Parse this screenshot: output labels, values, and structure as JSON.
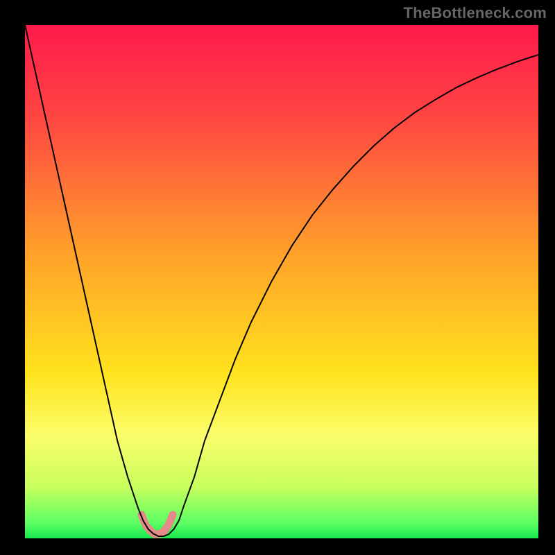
{
  "watermark": "TheBottleneck.com",
  "gradient": {
    "stops": [
      {
        "offset": 0,
        "color": "#ff1a4b"
      },
      {
        "offset": 0.18,
        "color": "#ff4642"
      },
      {
        "offset": 0.45,
        "color": "#ffa329"
      },
      {
        "offset": 0.68,
        "color": "#ffe31d"
      },
      {
        "offset": 0.8,
        "color": "#fbfd6a"
      },
      {
        "offset": 0.9,
        "color": "#c8ff5e"
      },
      {
        "offset": 0.97,
        "color": "#5dff63"
      },
      {
        "offset": 1.0,
        "color": "#17e84e"
      }
    ]
  },
  "curve": {
    "stroke": "#000000",
    "stroke_width": 2
  },
  "highlight": {
    "stroke": "#e58a88",
    "stroke_width": 11,
    "linecap": "round",
    "dot_radius": 5.5
  },
  "chart_data": {
    "type": "line",
    "title": "",
    "xlabel": "",
    "ylabel": "",
    "xlim": [
      0,
      100
    ],
    "ylim": [
      0,
      100
    ],
    "x": [
      0,
      2,
      4,
      6,
      8,
      10,
      12,
      14,
      16,
      18,
      20,
      22,
      23,
      24,
      25,
      26,
      27,
      28,
      29,
      30,
      31,
      33,
      35,
      38,
      41,
      44,
      48,
      52,
      56,
      60,
      64,
      68,
      72,
      76,
      80,
      84,
      88,
      92,
      96,
      100
    ],
    "y": [
      100,
      91,
      82,
      73,
      64,
      55,
      46,
      37,
      28,
      19,
      12,
      6,
      3.5,
      1.8,
      0.9,
      0.4,
      0.4,
      0.8,
      1.8,
      3.5,
      6.5,
      12,
      19,
      27,
      35,
      42,
      50,
      57,
      63,
      68,
      72.5,
      76.5,
      80,
      83,
      85.5,
      87.8,
      89.7,
      91.4,
      92.9,
      94.2
    ],
    "annotations": [
      {
        "type": "highlight-segment",
        "x": [
          22.7,
          23.5,
          24.5,
          25.3,
          26.1,
          27.0,
          27.9,
          28.8
        ],
        "y": [
          4.6,
          2.6,
          1.4,
          0.8,
          0.8,
          1.3,
          2.5,
          4.6
        ]
      }
    ]
  }
}
